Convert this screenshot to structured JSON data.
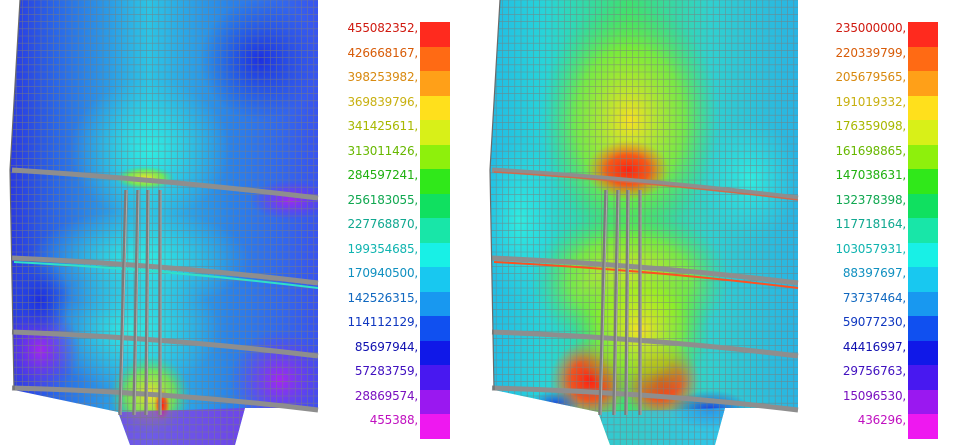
{
  "panels": [
    {
      "id": "left",
      "scheme": "low-stress",
      "legend_labels": [
        "455082352,",
        "426668167,",
        "398253982,",
        "369839796,",
        "341425611,",
        "313011426,",
        "284597241,",
        "256183055,",
        "227768870,",
        "199354685,",
        "170940500,",
        "142526315,",
        "114112129,",
        "85697944,",
        "57283759,",
        "28869574,",
        "455388,"
      ]
    },
    {
      "id": "right",
      "scheme": "high-stress",
      "legend_labels": [
        "235000000,",
        "220339799,",
        "205679565,",
        "191019332,",
        "176359098,",
        "161698865,",
        "147038631,",
        "132378398,",
        "117718164,",
        "103057931,",
        "88397697,",
        "73737464,",
        "59077230,",
        "44416997,",
        "29756763,",
        "15096530,",
        "436296,"
      ]
    }
  ],
  "legend_colors": [
    "#ff2a1e",
    "#ff6a14",
    "#ffa018",
    "#ffe01c",
    "#d8f018",
    "#8ef00c",
    "#30e81a",
    "#10e060",
    "#18e6a8",
    "#18f0e6",
    "#18c8f0",
    "#1898f0",
    "#1050f0",
    "#1018e8",
    "#4818f0",
    "#9a18f0",
    "#ee18f0"
  ],
  "label_colors": [
    "#d01a10",
    "#d85c08",
    "#d88a10",
    "#c8b010",
    "#a8b800",
    "#68b800",
    "#20b010",
    "#10a850",
    "#10a890",
    "#10b4b0",
    "#1090c0",
    "#1068c0",
    "#1038c0",
    "#1010b0",
    "#4010c0",
    "#7a10c0",
    "#c010c0"
  ]
}
